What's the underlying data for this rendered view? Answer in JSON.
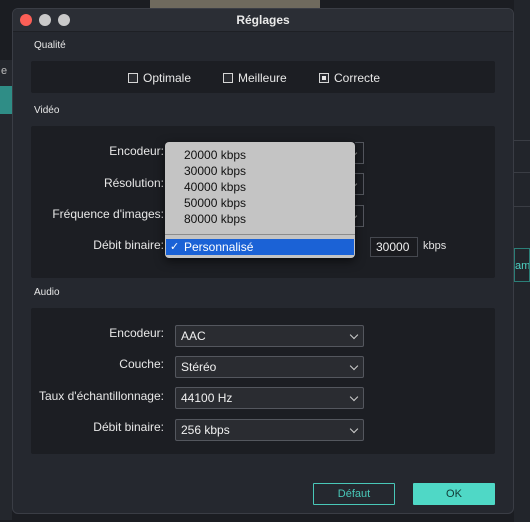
{
  "window": {
    "title": "Réglages"
  },
  "quality": {
    "section_title": "Qualité",
    "options": [
      {
        "label": "Optimale",
        "checked": false
      },
      {
        "label": "Meilleure",
        "checked": false
      },
      {
        "label": "Correcte",
        "checked": true
      }
    ]
  },
  "video": {
    "section_title": "Vidéo",
    "encoder_label": "Encodeur:",
    "resolution_label": "Résolution:",
    "framerate_label": "Fréquence d'images:",
    "bitrate_label": "Débit binaire:",
    "bitrate_value": "30000",
    "bitrate_unit": "kbps",
    "bitrate_dropdown": {
      "options": [
        "20000 kbps",
        "30000 kbps",
        "40000 kbps",
        "50000 kbps",
        "80000 kbps"
      ],
      "selected": "Personnalisé",
      "check_glyph": "✓"
    }
  },
  "audio": {
    "section_title": "Audio",
    "encoder_label": "Encodeur:",
    "encoder_value": "AAC",
    "channel_label": "Couche:",
    "channel_value": "Stéréo",
    "samplerate_label": "Taux d'échantillonnage:",
    "samplerate_value": "44100 Hz",
    "bitrate_label": "Débit binaire:",
    "bitrate_value": "256 kbps"
  },
  "buttons": {
    "default_label": "Défaut",
    "ok_label": "OK"
  },
  "background": {
    "left_glyph": "e",
    "right_text": "amè"
  },
  "colors": {
    "accent": "#4fd8c6",
    "selection": "#1b62d6"
  }
}
